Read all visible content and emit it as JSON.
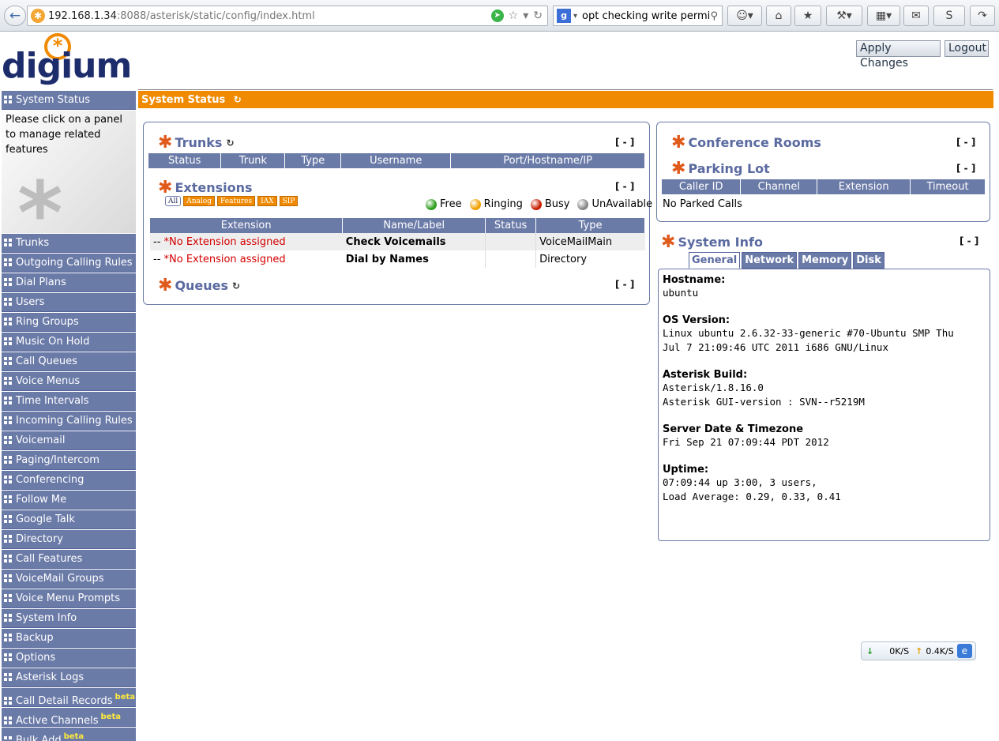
{
  "browser": {
    "url_host": "192.168.1.34",
    "url_rest": ":8088/asterisk/static/config/index.html",
    "search_text": "opt checking write permiss",
    "icons": [
      "back-icon",
      "refresh-icon",
      "star-icon",
      "home-icon",
      "bookmark-icon",
      "tools-icon",
      "skype-icon",
      "share-icon"
    ]
  },
  "header": {
    "logo_text": "digium",
    "apply_label": "Apply Changes",
    "logout_label": "Logout"
  },
  "sidebar": {
    "top_item": "System Status",
    "help_text": "Please click on a panel to manage related features",
    "items": [
      {
        "label": "Trunks"
      },
      {
        "label": "Outgoing Calling Rules"
      },
      {
        "label": "Dial Plans"
      },
      {
        "label": "Users"
      },
      {
        "label": "Ring Groups"
      },
      {
        "label": "Music On Hold"
      },
      {
        "label": "Call Queues"
      },
      {
        "label": "Voice Menus"
      },
      {
        "label": "Time Intervals"
      },
      {
        "label": "Incoming Calling Rules"
      },
      {
        "label": "Voicemail"
      },
      {
        "label": "Paging/Intercom"
      },
      {
        "label": "Conferencing"
      },
      {
        "label": "Follow Me"
      },
      {
        "label": "Google Talk"
      },
      {
        "label": "Directory"
      },
      {
        "label": "Call Features"
      },
      {
        "label": "VoiceMail Groups"
      },
      {
        "label": "Voice Menu Prompts"
      },
      {
        "label": "System Info"
      },
      {
        "label": "Backup"
      },
      {
        "label": "Options"
      },
      {
        "label": "Asterisk Logs"
      },
      {
        "label": "Call Detail Records",
        "beta": "beta"
      },
      {
        "label": "Active Channels",
        "beta": "beta"
      },
      {
        "label": "Bulk Add",
        "beta": "beta"
      }
    ]
  },
  "main": {
    "status_title": "System Status",
    "collapse": "[ - ]",
    "trunks": {
      "title": "Trunks",
      "columns": [
        "Status",
        "Trunk",
        "Type",
        "Username",
        "Port/Hostname/IP"
      ]
    },
    "extensions": {
      "title": "Extensions",
      "filters": [
        "All",
        "Analog",
        "Features",
        "IAX",
        "SIP"
      ],
      "legend": [
        {
          "label": "Free",
          "color": "#2e9e1e"
        },
        {
          "label": "Ringing",
          "color": "#f0a000"
        },
        {
          "label": "Busy",
          "color": "#c81e00"
        },
        {
          "label": "UnAvailable",
          "color": "#888888"
        }
      ],
      "columns": [
        "Extension",
        "Name/Label",
        "Status",
        "Type"
      ],
      "rows": [
        {
          "prefix": "--",
          "extension": "*No Extension assigned",
          "name": "Check Voicemails",
          "status": "",
          "type": "VoiceMailMain"
        },
        {
          "prefix": "--",
          "extension": "*No Extension assigned",
          "name": "Dial by Names",
          "status": "",
          "type": "Directory"
        }
      ]
    },
    "queues": {
      "title": "Queues"
    },
    "conference": {
      "title": "Conference Rooms"
    },
    "parking": {
      "title": "Parking Lot",
      "columns": [
        "Caller ID",
        "Channel",
        "Extension",
        "Timeout"
      ],
      "empty": "No Parked Calls"
    },
    "sysinfo": {
      "title": "System Info",
      "tabs": [
        "General",
        "Network",
        "Memory",
        "Disk"
      ],
      "active_tab": "General",
      "sections": [
        {
          "label": "Hostname:",
          "value": "ubuntu"
        },
        {
          "label": "OS Version:",
          "value": "Linux ubuntu 2.6.32-33-generic #70-Ubuntu SMP Thu\nJul 7 21:09:46 UTC 2011 i686 GNU/Linux"
        },
        {
          "label": "Asterisk Build:",
          "value": "Asterisk/1.8.16.0\nAsterisk GUI-version : SVN--r5219M"
        },
        {
          "label": "Server Date & Timezone",
          "value": "Fri Sep 21 07:09:44 PDT 2012"
        },
        {
          "label": "Uptime:",
          "value": "07:09:44 up 3:00, 3 users,\nLoad Average: 0.29, 0.33, 0.41"
        }
      ]
    }
  },
  "netspeed": {
    "down": "0K/S",
    "up": "0.4K/S"
  }
}
